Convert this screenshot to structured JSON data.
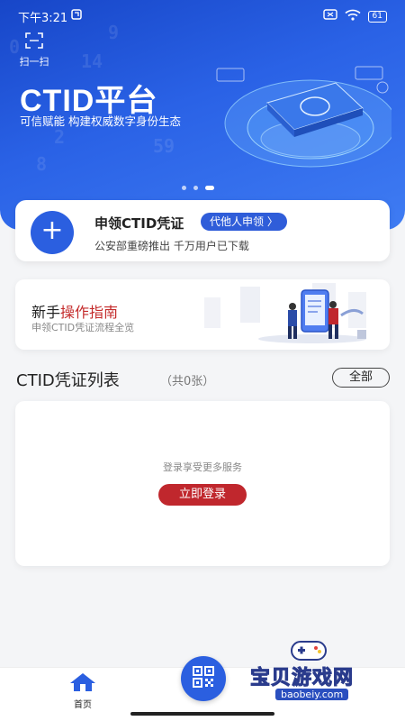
{
  "status_bar": {
    "time": "下午3:21",
    "battery": "61"
  },
  "hero": {
    "scan_label": "扫一扫",
    "title": "CTID平台",
    "subtitle": "可信赋能  构建权威数字身份生态",
    "carousel_pages": 3,
    "carousel_active": 3
  },
  "apply_card": {
    "title": "申领CTID凭证",
    "proxy_button": "代他人申领 〉",
    "description": "公安部重磅推出  千万用户已下载"
  },
  "guide_card": {
    "title_part1": "新手",
    "title_part2": "操作指南",
    "description": "申领CTID凭证流程全览"
  },
  "credential_list": {
    "title": "CTID凭证列表",
    "count": "（共0张）",
    "all_button": "全部",
    "empty_hint": "登录享受更多服务",
    "login_button": "立即登录"
  },
  "bottom_nav": {
    "home_label": "首页"
  },
  "watermark": {
    "title": "宝贝游戏网",
    "url": "baobeiy.com"
  },
  "colors": {
    "brand_blue": "#2b5fe0",
    "accent_red": "#c0272d"
  }
}
